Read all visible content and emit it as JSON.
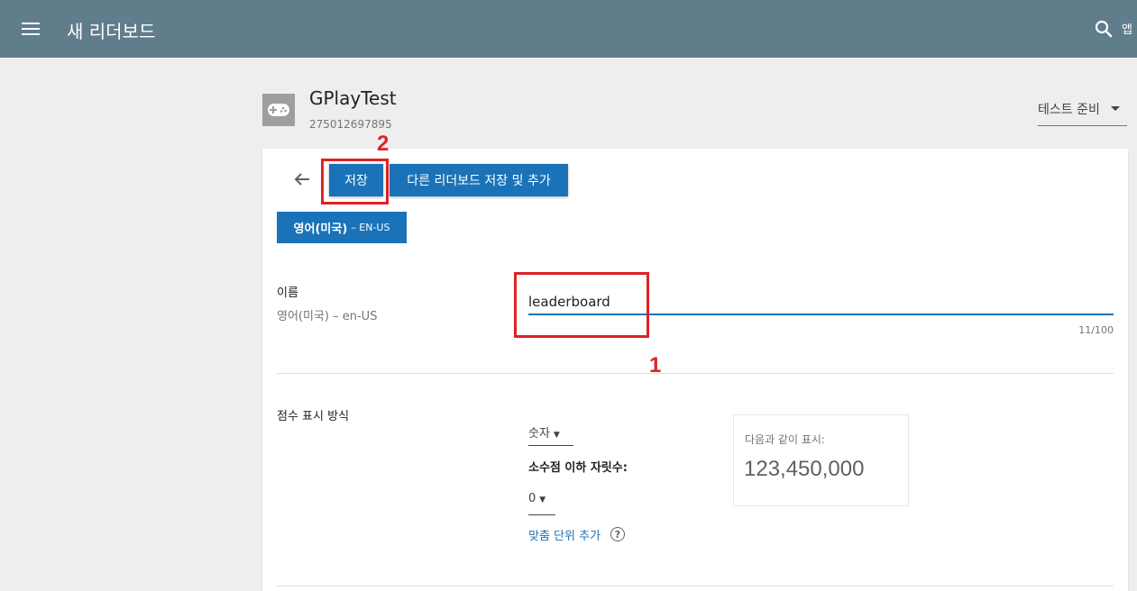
{
  "header": {
    "title": "새 리더보드",
    "apps_label": "앱",
    "menu_icon": "hamburger-icon",
    "search_icon": "search-icon"
  },
  "app": {
    "name": "GPlayTest",
    "id": "275012697895",
    "icon": "gamepad-icon",
    "status": "테스트 준비"
  },
  "toolbar": {
    "save_label": "저장",
    "save_add_label": "다른 리더보드 저장 및 추가"
  },
  "language_tab": {
    "name": "영어(미국)",
    "code": "– EN-US"
  },
  "name_field": {
    "label": "이름",
    "sublabel": "영어(미국) – en-US",
    "value": "leaderboard",
    "char_count": "11/100"
  },
  "score_format": {
    "label": "점수 표시 방식",
    "type_value": "숫자",
    "decimals_label": "소수점 이하 자릿수:",
    "decimals_value": "0",
    "custom_unit_link": "맞춤 단위 추가",
    "preview_label": "다음과 같이 표시:",
    "preview_value": "123,450,000"
  },
  "annotations": {
    "one": "1",
    "two": "2",
    "color": "#e02127"
  },
  "colors": {
    "header_bg": "#607d8b",
    "primary": "#1a73b8"
  }
}
